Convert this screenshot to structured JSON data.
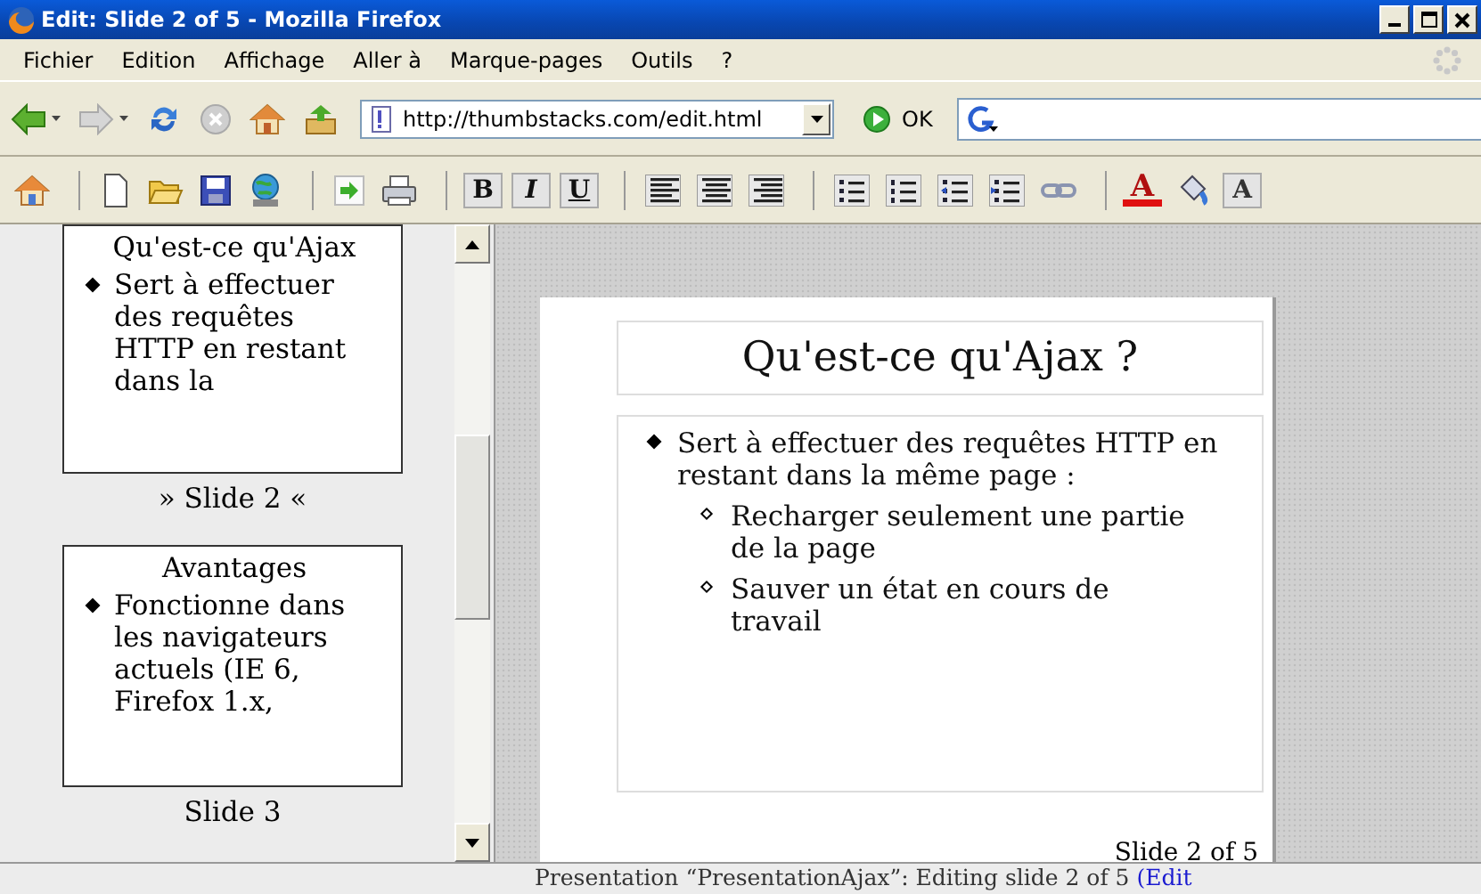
{
  "window": {
    "title": "Edit: Slide 2 of 5 - Mozilla Firefox"
  },
  "menu": [
    {
      "label": "Fichier"
    },
    {
      "label": "Edition"
    },
    {
      "label": "Affichage"
    },
    {
      "label": "Aller à"
    },
    {
      "label": "Marque-pages"
    },
    {
      "label": "Outils"
    },
    {
      "label": "?"
    }
  ],
  "navigation": {
    "buttons": [
      {
        "kind": "back",
        "disabled": false,
        "dropdown": true
      },
      {
        "kind": "forward",
        "disabled": true,
        "dropdown": true
      },
      {
        "kind": "reload",
        "disabled": false,
        "dropdown": false
      },
      {
        "kind": "stop",
        "disabled": true,
        "dropdown": false
      },
      {
        "kind": "home",
        "disabled": false,
        "dropdown": false
      },
      {
        "kind": "bookmark",
        "disabled": false,
        "dropdown": false
      }
    ],
    "url": "http://thumbstacks.com/edit.html",
    "go_label": "OK"
  },
  "editor_toolbar": [
    {
      "kind": "home"
    },
    {
      "kind": "separator"
    },
    {
      "kind": "new"
    },
    {
      "kind": "open"
    },
    {
      "kind": "save"
    },
    {
      "kind": "publish"
    },
    {
      "kind": "separator"
    },
    {
      "kind": "play"
    },
    {
      "kind": "print"
    },
    {
      "kind": "separator"
    },
    {
      "kind": "bold",
      "label": "B"
    },
    {
      "kind": "italic",
      "label": "I"
    },
    {
      "kind": "underline",
      "label": "U"
    },
    {
      "kind": "separator"
    },
    {
      "kind": "align-left"
    },
    {
      "kind": "align-center"
    },
    {
      "kind": "align-right"
    },
    {
      "kind": "separator"
    },
    {
      "kind": "bullets"
    },
    {
      "kind": "numbers"
    },
    {
      "kind": "outdent"
    },
    {
      "kind": "indent"
    },
    {
      "kind": "link"
    },
    {
      "kind": "separator"
    },
    {
      "kind": "text-color",
      "label": "A"
    },
    {
      "kind": "fill"
    },
    {
      "kind": "highlight",
      "label": "A"
    }
  ],
  "thumbnails": [
    {
      "title": "Qu'est-ce qu'Ajax",
      "bullets": [
        "Sert à effectuer des requêtes HTTP en restant dans la"
      ],
      "caption": "» Slide 2 «"
    },
    {
      "title": "Avantages",
      "bullets": [
        "Fonctionne dans les navigateurs actuels (IE 6, Firefox 1.x,"
      ],
      "caption": "Slide 3"
    }
  ],
  "slide": {
    "title": "Qu'est-ce qu'Ajax ?",
    "bullets": [
      {
        "text": "Sert à effectuer des requêtes HTTP en restant dans la même page :",
        "children": [
          {
            "text": "Recharger seulement une partie de la page"
          },
          {
            "text": "Sauver un état en cours de travail"
          }
        ]
      }
    ],
    "footer": "Slide 2 of 5"
  },
  "status": {
    "text": "Presentation “PresentationAjax”: Editing slide 2 of 5",
    "link": "(Edit"
  }
}
